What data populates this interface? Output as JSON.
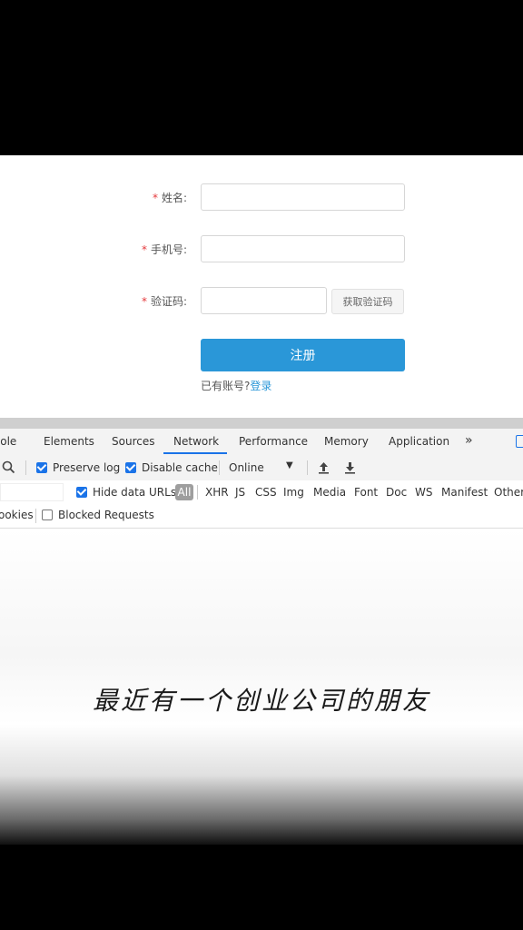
{
  "form": {
    "name_label": "姓名:",
    "phone_label": "手机号:",
    "code_label": "验证码:",
    "required_mark": "*",
    "get_code_label": "获取验证码",
    "submit_label": "注册",
    "have_account_text": "已有账号?",
    "login_link": "登录"
  },
  "devtools": {
    "tabs": [
      "sole",
      "Elements",
      "Sources",
      "Network",
      "Performance",
      "Memory",
      "Application",
      "»"
    ],
    "active_tab": "Network",
    "preserve_log_label": "Preserve log",
    "preserve_log_checked": true,
    "disable_cache_label": "Disable cache",
    "disable_cache_checked": true,
    "throttle_value": "Online",
    "hide_data_urls_label": "Hide data URLs",
    "hide_data_urls_checked": true,
    "filter_types": [
      "All",
      "XHR",
      "JS",
      "CSS",
      "Img",
      "Media",
      "Font",
      "Doc",
      "WS",
      "Manifest",
      "Other"
    ],
    "cookies_label": "ookies",
    "blocked_requests_label": "Blocked Requests",
    "blocked_requests_checked": false
  },
  "caption": "最近有一个创业公司的朋友",
  "colors": {
    "accent": "#2a97d8",
    "devtools_accent": "#1a73e8",
    "required": "#e4393c"
  }
}
